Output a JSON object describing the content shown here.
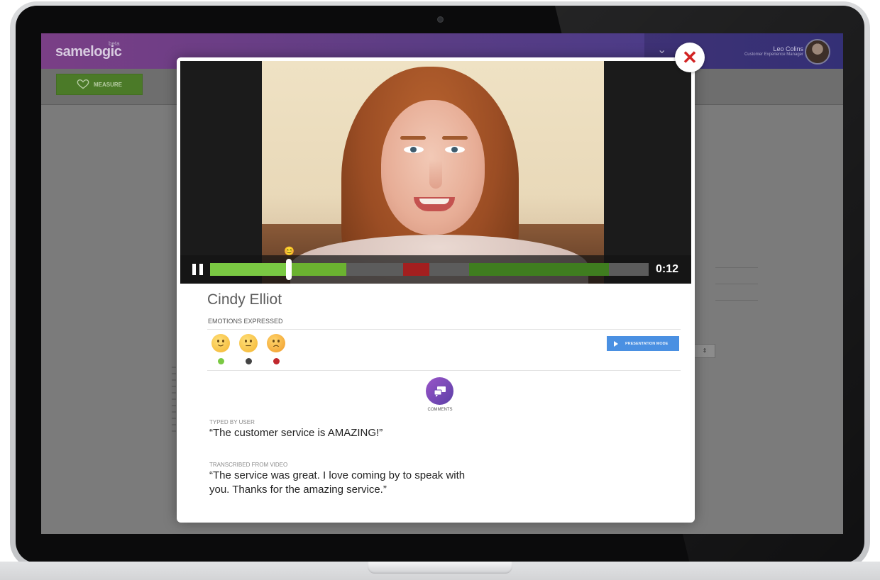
{
  "app": {
    "brand": "samelogic",
    "brand_tag": "beta",
    "toolbar": {
      "measure_label": "MEASURE"
    },
    "user": {
      "name": "Leo Colins",
      "role": "Customer Experience Manager"
    }
  },
  "modal": {
    "close_symbol": "✕",
    "video": {
      "time": "0:12",
      "progress": 0.18,
      "segments": [
        {
          "start": 0.0,
          "end": 0.31,
          "color": "#6bb230"
        },
        {
          "start": 0.31,
          "end": 0.44,
          "color": "#5c5c5c"
        },
        {
          "start": 0.44,
          "end": 0.5,
          "color": "#a31f1f"
        },
        {
          "start": 0.5,
          "end": 0.59,
          "color": "#5c5c5c"
        },
        {
          "start": 0.59,
          "end": 0.91,
          "color": "#3f7d1f"
        },
        {
          "start": 0.91,
          "end": 1.0,
          "color": "#5c5c5c"
        }
      ],
      "marker_emoji": "😊"
    },
    "person_name": "Cindy Elliot",
    "emotions_label": "EMOTIONS EXPRESSED",
    "emotions": [
      {
        "name": "happy",
        "dot_color": "#7ac943"
      },
      {
        "name": "neutral",
        "dot_color": "#444444"
      },
      {
        "name": "angry",
        "dot_color": "#c1272d"
      }
    ],
    "presentation_button": "PRESENTATION MODE",
    "comments_label": "COMMENTS",
    "typed_label": "TYPED BY USER",
    "typed_quote": "“The customer service is AMAZING!”",
    "transcribed_label": "TRANSCRIBED FROM VIDEO",
    "transcribed_quote": "“The service was great. I love coming by to speak with you. Thanks for the amazing service.”"
  },
  "colors": {
    "header_purple": "#5a3d85",
    "measure_green": "#4b7a28",
    "close_red": "#d22323",
    "presentation_blue": "#4a90e2",
    "comments_purple": "#7a4ab8"
  }
}
